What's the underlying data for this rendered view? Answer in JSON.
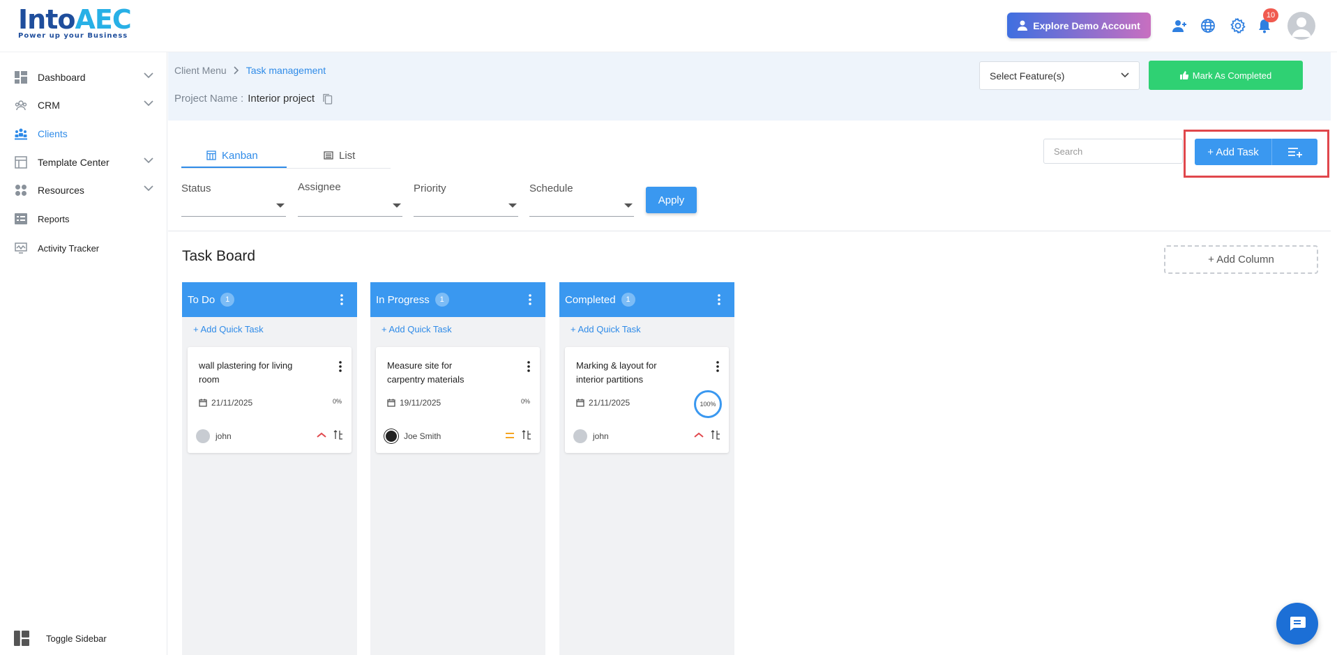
{
  "app": {
    "logo_text": "IntoAEC",
    "logo_tagline": "Power up your Business",
    "demo_button": "Explore Demo Account",
    "notification_count": "10"
  },
  "sidebar": {
    "items": [
      {
        "label": "Dashboard",
        "icon": "dashboard-icon",
        "has_chevron": true,
        "active": false
      },
      {
        "label": "CRM",
        "icon": "crm-icon",
        "has_chevron": true,
        "active": false
      },
      {
        "label": "Clients",
        "icon": "clients-icon",
        "has_chevron": false,
        "active": true
      },
      {
        "label": "Template Center",
        "icon": "template-icon",
        "has_chevron": true,
        "active": false
      },
      {
        "label": "Resources",
        "icon": "resources-icon",
        "has_chevron": true,
        "active": false
      },
      {
        "label": "Reports",
        "icon": "reports-icon",
        "has_chevron": false,
        "active": false
      },
      {
        "label": "Activity Tracker",
        "icon": "activity-icon",
        "has_chevron": false,
        "active": false
      }
    ],
    "toggle_label": "Toggle Sidebar"
  },
  "header": {
    "breadcrumb": [
      "Client Menu",
      "Task management"
    ],
    "project_label": "Project Name :",
    "project_value": "Interior project",
    "feature_select": "Select Feature(s)",
    "mark_completed": "Mark As Completed"
  },
  "tabs": [
    {
      "label": "Kanban",
      "active": true
    },
    {
      "label": "List",
      "active": false
    }
  ],
  "toolbar": {
    "search_placeholder": "Search",
    "add_task": "+ Add Task"
  },
  "filters": [
    {
      "label": "Status"
    },
    {
      "label": "Assignee"
    },
    {
      "label": "Priority"
    },
    {
      "label": "Schedule"
    }
  ],
  "apply_label": "Apply",
  "board": {
    "title": "Task Board",
    "add_column": "+ Add Column",
    "quick_task": "+ Add Quick Task",
    "columns": [
      {
        "title": "To Do",
        "count": "1",
        "card": {
          "title": "wall plastering for living room",
          "date": "21/11/2025",
          "progress": "0%",
          "assignee": "john",
          "priority": "high"
        }
      },
      {
        "title": "In Progress",
        "count": "1",
        "card": {
          "title": "Measure site for carpentry materials",
          "date": "19/11/2025",
          "progress": "0%",
          "assignee": "Joe Smith",
          "priority": "medium"
        }
      },
      {
        "title": "Completed",
        "count": "1",
        "card": {
          "title": "Marking & layout for interior partitions",
          "date": "21/11/2025",
          "progress": "100%",
          "assignee": "john",
          "priority": "high"
        }
      }
    ]
  },
  "colors": {
    "accent": "#3a98f0",
    "success": "#2fd173",
    "priority_high": "#e0474c",
    "priority_medium": "#f5a623",
    "highlight": "#e0474c"
  }
}
